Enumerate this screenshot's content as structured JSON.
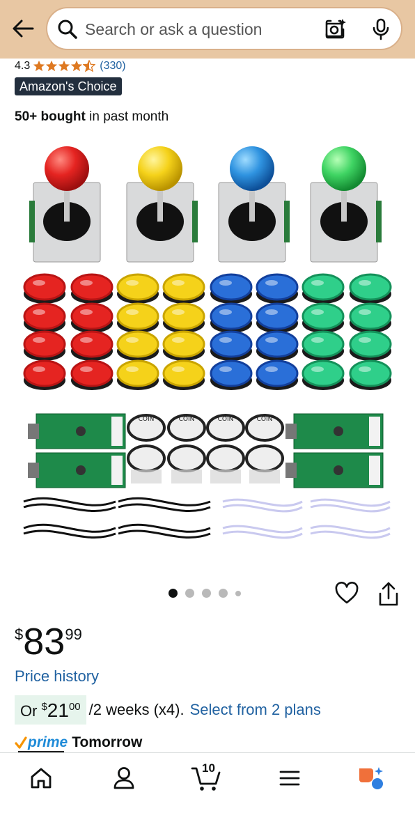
{
  "header": {
    "back_icon": "arrow-left-icon",
    "search_placeholder": "Search or ask a question",
    "search_icon": "search-icon",
    "lens_icon": "camera-lens-icon",
    "mic_icon": "microphone-icon",
    "bar_color": "#e8c7a3"
  },
  "product": {
    "rating_value": "4.3",
    "rating_stars": 4.3,
    "review_count": "(330)",
    "badge": "Amazon's Choice",
    "bought_bold": "50+ bought",
    "bought_rest": " in past month",
    "image_icon": "arcade-kit-product-image",
    "carousel": {
      "count": 5,
      "active_index": 0
    },
    "favorite_icon": "heart-icon",
    "share_icon": "share-icon"
  },
  "pricing": {
    "symbol": "$",
    "whole": "83",
    "fraction": "99",
    "price_history_label": "Price history",
    "installment": {
      "prefix": "Or",
      "symbol": "$",
      "whole": "21",
      "fraction": "00",
      "rest": "/2 weeks (x4).",
      "link": "Select from 2 plans"
    }
  },
  "delivery": {
    "prime_label": "prime",
    "day": "Tomorrow"
  },
  "bottom_nav": {
    "items": [
      {
        "name": "home",
        "icon": "home-icon"
      },
      {
        "name": "account",
        "icon": "person-icon"
      },
      {
        "name": "cart",
        "icon": "cart-icon"
      },
      {
        "name": "menu",
        "icon": "menu-icon"
      },
      {
        "name": "rufus",
        "icon": "rufus-assistant-icon"
      }
    ],
    "cart_count": "10"
  },
  "colors": {
    "link": "#2162a1",
    "prime_blue": "#1f8bd8",
    "badge_bg": "#232f3e",
    "installment_bg": "#e6f4ec"
  }
}
